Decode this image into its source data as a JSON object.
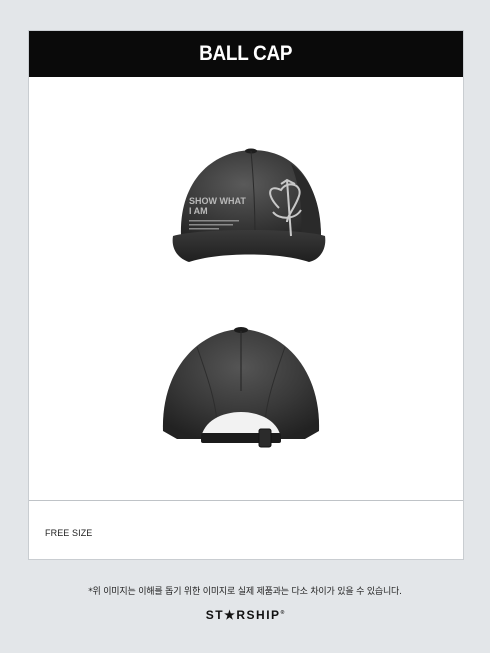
{
  "product": {
    "title": "BALL CAP",
    "size": "FREE SIZE",
    "cap_front_print_line1": "SHOW WHAT",
    "cap_front_print_line2": "I AM"
  },
  "images": {
    "front_view": "cap-front-view",
    "back_view": "cap-back-view"
  },
  "footer": {
    "notice": "*위 이미지는 이해를 돕기 위한 이미지로 실제 제품과는 다소 차이가 있을 수 있습니다.",
    "brand_logo": "STARSHIP"
  },
  "colors": {
    "background": "#e3e6e9",
    "header_bg": "#0a0a0a",
    "header_text": "#ffffff",
    "cap": "#3a3a3a"
  }
}
